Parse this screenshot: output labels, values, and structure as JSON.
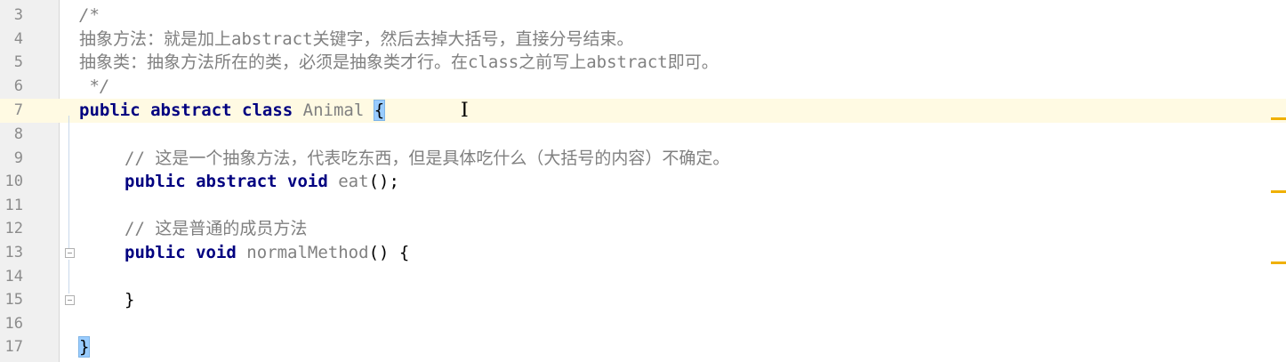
{
  "editor": {
    "line_numbers": [
      "3",
      "4",
      "5",
      "6",
      "7",
      "8",
      "9",
      "10",
      "11",
      "12",
      "13",
      "14",
      "15",
      "16",
      "17"
    ],
    "lines": {
      "l3": "/*",
      "l4": "抽象方法：就是加上abstract关键字，然后去掉大括号，直接分号结束。",
      "l5": "抽象类：抽象方法所在的类，必须是抽象类才行。在class之前写上abstract即可。",
      "l6": " */",
      "l7_kw": "public abstract class",
      "l7_name": "Animal",
      "l7_brace": "{",
      "l9": "// 这是一个抽象方法，代表吃东西，但是具体吃什么（大括号的内容）不确定。",
      "l10_kw": "public abstract void",
      "l10_rest": "eat",
      "l10_tail": "();",
      "l12": "// 这是普通的成员方法",
      "l13_kw": "public void",
      "l13_name": "normalMethod",
      "l13_tail": "() {",
      "l15": "}",
      "l17": "}"
    },
    "colors": {
      "keyword": "#000080",
      "comment": "#808080",
      "current_line": "#fffae3",
      "brace_highlight": "#99ccff",
      "stripe_marker": "#f0b000"
    }
  }
}
